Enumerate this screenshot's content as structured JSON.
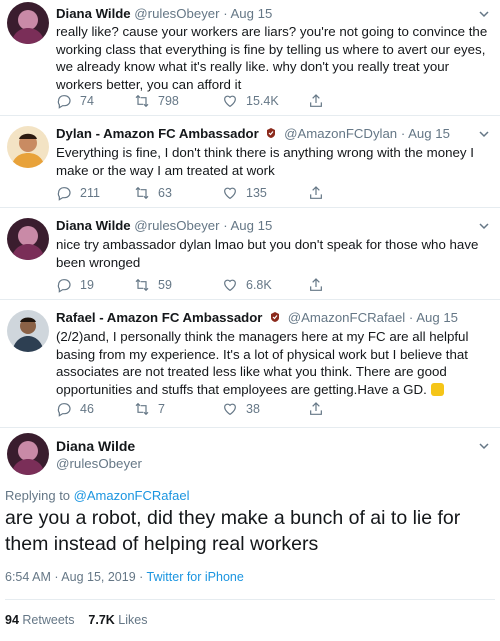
{
  "tweets": [
    {
      "name": "Diana Wilde",
      "handle": "@rulesObeyer",
      "date": "· Aug 15",
      "text": "really like? cause your workers are liars? you're not going to convince the working class that everything is fine by telling us where to avert our eyes, we already know what it's really like. why don't you really treat your workers better, you can afford it",
      "replies": "74",
      "retweets": "798",
      "likes": "15.4K"
    },
    {
      "name": "Dylan - Amazon FC Ambassador",
      "handle": "@AmazonFCDylan",
      "date": "· Aug 15",
      "text": "Everything is fine, I don't think there is anything wrong with the money I make or the way I am treated at work",
      "replies": "211",
      "retweets": "63",
      "likes": "135"
    },
    {
      "name": "Diana Wilde",
      "handle": "@rulesObeyer",
      "date": "· Aug 15",
      "text": "nice try ambassador dylan lmao but you don't speak for those who have been wronged",
      "replies": "19",
      "retweets": "59",
      "likes": "6.8K"
    },
    {
      "name": "Rafael - Amazon FC Ambassador",
      "handle": "@AmazonFCRafael",
      "date": "· Aug 15",
      "text": "(2/2)and, I personally think the managers here at my FC are all helpful basing from my experience. It's a lot of physical work but I believe that associates are not treated less like what you think. There are good opportunities and stuffs that employees are getting.Have a GD.",
      "replies": "46",
      "retweets": "7",
      "likes": "38"
    }
  ],
  "main": {
    "name": "Diana Wilde",
    "handle": "@rulesObeyer",
    "replying_label": "Replying to",
    "replying_to": "@AmazonFCRafael",
    "text": "are you a robot, did they make a bunch of ai to lie for them instead of helping real workers",
    "timestamp": "6:54 AM · Aug 15, 2019 · ",
    "source": "Twitter for iPhone",
    "retweets_count": "94",
    "retweets_label": "Retweets",
    "likes_count": "7.7K",
    "likes_label": "Likes"
  },
  "colors": {
    "muted": "#657786",
    "link": "#1b95e0",
    "divider": "#e6ecf0",
    "amazon_badge": "#8b2a1c"
  }
}
